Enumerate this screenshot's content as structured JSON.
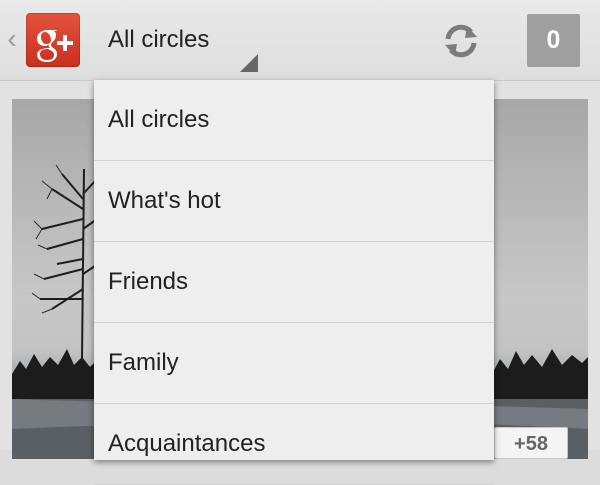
{
  "actionbar": {
    "back_glyph": "‹",
    "logo_icon": "google-plus-logo",
    "selected_circle": "All circles",
    "refresh_icon": "refresh-icon",
    "notification_count": "0"
  },
  "content": {
    "plus_count": "+58"
  },
  "dropdown": {
    "items": [
      {
        "label": "All circles"
      },
      {
        "label": "What's hot"
      },
      {
        "label": "Friends"
      },
      {
        "label": "Family"
      },
      {
        "label": "Acquaintances"
      }
    ]
  },
  "colors": {
    "logo_red": "#d73d29",
    "badge_gray": "#9f9f9f",
    "menu_bg": "#eeeeee"
  }
}
